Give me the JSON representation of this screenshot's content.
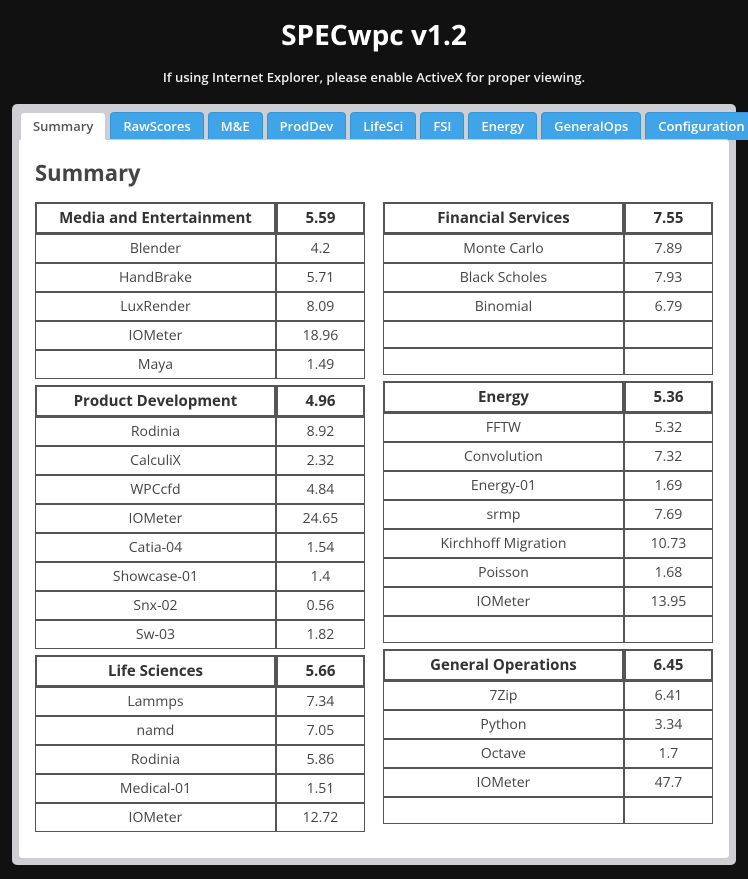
{
  "header": {
    "title": "SPECwpc v1.2",
    "notice": "If using Internet Explorer, please enable ActiveX for proper viewing."
  },
  "tabs": [
    {
      "label": "Summary",
      "active": true
    },
    {
      "label": "RawScores",
      "active": false
    },
    {
      "label": "M&E",
      "active": false
    },
    {
      "label": "ProdDev",
      "active": false
    },
    {
      "label": "LifeSci",
      "active": false
    },
    {
      "label": "FSI",
      "active": false
    },
    {
      "label": "Energy",
      "active": false
    },
    {
      "label": "GeneralOps",
      "active": false
    },
    {
      "label": "Configuration",
      "active": false
    }
  ],
  "content_heading": "Summary",
  "left_col": [
    {
      "title": "Media and Entertainment",
      "score": "5.59",
      "rows": [
        {
          "name": "Blender",
          "val": "4.2"
        },
        {
          "name": "HandBrake",
          "val": "5.71"
        },
        {
          "name": "LuxRender",
          "val": "8.09"
        },
        {
          "name": "IOMeter",
          "val": "18.96"
        },
        {
          "name": "Maya",
          "val": "1.49"
        }
      ]
    },
    {
      "title": "Product Development",
      "score": "4.96",
      "rows": [
        {
          "name": "Rodinia",
          "val": "8.92"
        },
        {
          "name": "CalculiX",
          "val": "2.32"
        },
        {
          "name": "WPCcfd",
          "val": "4.84"
        },
        {
          "name": "IOMeter",
          "val": "24.65"
        },
        {
          "name": "Catia-04",
          "val": "1.54"
        },
        {
          "name": "Showcase-01",
          "val": "1.4"
        },
        {
          "name": "Snx-02",
          "val": "0.56"
        },
        {
          "name": "Sw-03",
          "val": "1.82"
        }
      ]
    },
    {
      "title": "Life Sciences",
      "score": "5.66",
      "rows": [
        {
          "name": "Lammps",
          "val": "7.34"
        },
        {
          "name": "namd",
          "val": "7.05"
        },
        {
          "name": "Rodinia",
          "val": "5.86"
        },
        {
          "name": "Medical-01",
          "val": "1.51"
        },
        {
          "name": "IOMeter",
          "val": "12.72"
        }
      ]
    }
  ],
  "right_col": [
    {
      "title": "Financial Services",
      "score": "7.55",
      "rows": [
        {
          "name": "Monte Carlo",
          "val": "7.89"
        },
        {
          "name": "Black Scholes",
          "val": "7.93"
        },
        {
          "name": "Binomial",
          "val": "6.79"
        },
        {
          "name": "",
          "val": ""
        },
        {
          "name": "",
          "val": ""
        }
      ]
    },
    {
      "title": "Energy",
      "score": "5.36",
      "rows": [
        {
          "name": "FFTW",
          "val": "5.32"
        },
        {
          "name": "Convolution",
          "val": "7.32"
        },
        {
          "name": "Energy-01",
          "val": "1.69"
        },
        {
          "name": "srmp",
          "val": "7.69"
        },
        {
          "name": "Kirchhoff Migration",
          "val": "10.73"
        },
        {
          "name": "Poisson",
          "val": "1.68"
        },
        {
          "name": "IOMeter",
          "val": "13.95"
        },
        {
          "name": "",
          "val": ""
        }
      ]
    },
    {
      "title": "General Operations",
      "score": "6.45",
      "rows": [
        {
          "name": "7Zip",
          "val": "6.41"
        },
        {
          "name": "Python",
          "val": "3.34"
        },
        {
          "name": "Octave",
          "val": "1.7"
        },
        {
          "name": "IOMeter",
          "val": "47.7"
        },
        {
          "name": "",
          "val": ""
        }
      ]
    }
  ]
}
